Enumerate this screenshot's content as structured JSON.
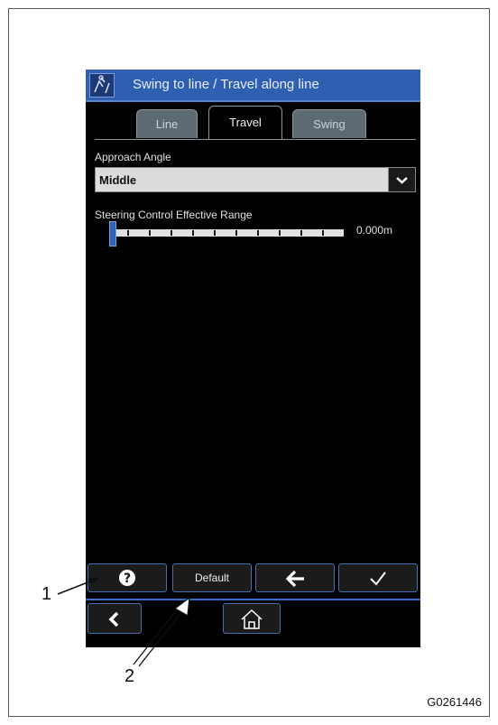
{
  "window": {
    "title": "Swing to line / Travel along line",
    "icon": "swing-travel-icon"
  },
  "tabs": [
    {
      "label": "Line",
      "state": "inactive"
    },
    {
      "label": "Travel",
      "state": "active"
    },
    {
      "label": "Swing",
      "state": "inactive"
    }
  ],
  "approach": {
    "label": "Approach Angle",
    "value": "Middle"
  },
  "steering": {
    "label": "Steering Control Effective Range",
    "value": "0.000m",
    "level": 0
  },
  "toolbar": {
    "help_icon": "question-icon",
    "default_label": "Default",
    "back_icon": "left-arrow-icon",
    "ok_icon": "checkmark-icon"
  },
  "nav": {
    "back_icon": "chevron-left-icon",
    "home_icon": "home-icon"
  },
  "callouts": {
    "one": "1",
    "two": "2"
  },
  "figure_code": "G0261446",
  "colors": {
    "accent": "#2f5fb0",
    "screen": "#000000",
    "tab_inactive": "#5d6a72"
  }
}
